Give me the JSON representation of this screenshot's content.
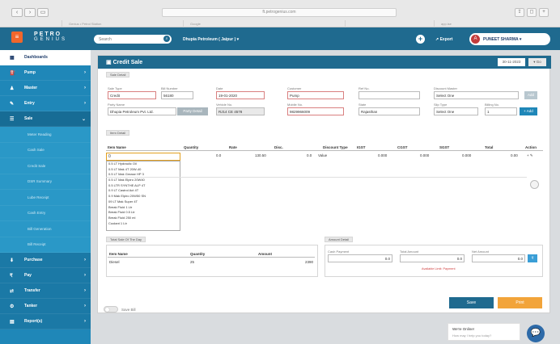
{
  "browser": {
    "nav_back": "‹",
    "nav_forward": "›",
    "nav_sidebar": "▭",
    "url": "ft.petrogenius.com",
    "tabs": [
      "Genius • Petrol Station",
      "Google",
      "",
      "app.ise"
    ],
    "right_buttons": [
      "⇪",
      "◻",
      "+"
    ]
  },
  "header": {
    "logo_mark": "≡",
    "logo_line1": "PETRO",
    "logo_line2": "GENIUS",
    "search_placeholder": "Search",
    "search_icon": "⌕",
    "station": "Dhupia Petroleum ( Jaipur ) ▾",
    "plus_label": "+",
    "export_label": "↗ Export",
    "user_initial": "A",
    "user_name": "PUNEET SHARMA ▾"
  },
  "sidebar": {
    "items": [
      {
        "icon": "▦",
        "label": "Dashboards"
      },
      {
        "icon": "⛽",
        "label": "Pump"
      },
      {
        "icon": "♟",
        "label": "Master"
      },
      {
        "icon": "✎",
        "label": "Entry"
      },
      {
        "icon": "☰",
        "label": "Sale"
      }
    ],
    "subitems": [
      "Meter Reading",
      "Cash Sale",
      "Credit Sale",
      "DSR Summary",
      "Lube Receipt",
      "Cash Entry",
      "Bill Generation",
      "Bill Receipt"
    ],
    "items_after": [
      {
        "icon": "⬇",
        "label": "Purchase"
      },
      {
        "icon": "₹",
        "label": "Pay"
      },
      {
        "icon": "⇄",
        "label": "Transfer"
      },
      {
        "icon": "⚙",
        "label": "Tanker"
      },
      {
        "icon": "▤",
        "label": "Report(s)"
      }
    ]
  },
  "panel": {
    "icon": "▣",
    "title": "Credit Sale",
    "date_value": "30-11-2023",
    "date_button": "▾ Go",
    "section_sale_detail": "Sale Detail",
    "fields": {
      "sale_type_label": "Sale Type",
      "sale_type_value": "Credit",
      "bill_number_label": "Bill Number",
      "bill_number_value": "56180",
      "date_label": "Date",
      "date_value": "19-01-2020",
      "customer_label": "Customer",
      "customer_value": "Pump",
      "ref_no_label": "Ref No.",
      "ref_no_value": "",
      "discount_label": "Discount Master",
      "discount_value": "Select One",
      "discount_button": "Add",
      "party_label": "Party Name",
      "party_value": "Dhupia Petroleum Pvt. Ltd.",
      "party_button": "Party Detail",
      "vehicle_label": "Vehicle No.",
      "vehicle_value": "RJ14 CE 4578",
      "mobile_label": "Mobile No.",
      "mobile_value": "9829966009",
      "state_label": "State",
      "state_value": "Rajasthan",
      "slip_label": "Slip Type",
      "slip_value": "Select One",
      "qty_label": "Billing No.",
      "qty_value": "1",
      "qty_button": "+ Add"
    },
    "section_item_detail": "Item Detail",
    "table_headers": [
      "Item Name",
      "Quantity",
      "Rate",
      "Disc.",
      "Discount Type",
      "IGST",
      "CGST",
      "SGST",
      "Total",
      "Action"
    ],
    "table_row": {
      "quantity": "0.0",
      "rate": "130.50",
      "disc": "0.0",
      "discount_type": "Value",
      "igst": "0.000",
      "cgst": "0.000",
      "sgst": "0.000",
      "total": "0.00",
      "action": "+ ✎"
    },
    "item_input": "0",
    "dropdown_items": [
      "0.5 LT Hydraulic Oil",
      "0.5 LT Mak 4T 20W-40",
      "0.5 LT Mak Grease HP 3",
      "0.5 LT Mak Elpiro 20W40",
      "0.5 LTR SYNTHE ALP 4T",
      "0.9 LT Castrol Act 4T",
      "0.9 Mak Elpiro 20W50 SN",
      "09 LT Mak Super 4T",
      "Break Fluid 1 Ltr",
      "Break Fluid 0.5 Ltr",
      "Break Fluid 250 ml",
      "Coolant 1 Ltr"
    ],
    "section_summary": "Total Sale Of The Day",
    "summary_headers": [
      "Item Name",
      "Quantity",
      "Amount"
    ],
    "summary_row": {
      "item": "Diesel",
      "qty": "25",
      "amount": "2390"
    },
    "section_amount": "Amount Detail",
    "amount_labels": [
      "Cash Payment",
      "Total Amount",
      "Net Amount"
    ],
    "amount_values": [
      "0.0",
      "0.0",
      "0.0"
    ],
    "amount_note": "Available Limit: Payment",
    "amount_button": "₹",
    "save_label": "Save",
    "print_label": "Print",
    "toggle_label": "Save Bill"
  },
  "chat": {
    "line1": "We're Online!",
    "line2": "How may I help you today?",
    "icon": "💬"
  }
}
